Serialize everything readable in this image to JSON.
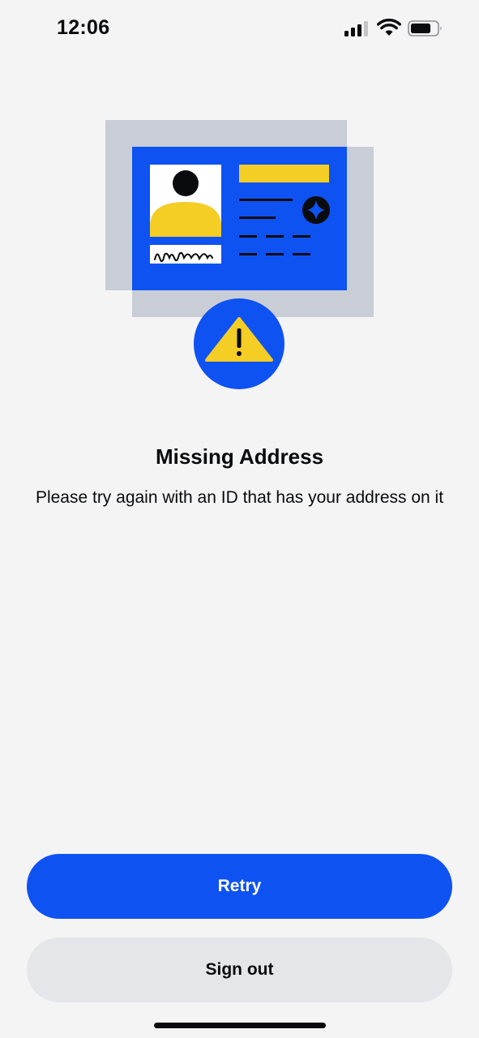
{
  "status_bar": {
    "time": "12:06",
    "icons": [
      "cellular-signal-icon",
      "wifi-icon",
      "battery-icon"
    ]
  },
  "illustration": {
    "icon": "id-card-warning-icon",
    "colors": {
      "card_blue": "#0e52f2",
      "shadow_gray": "#c9cdd6",
      "accent_yellow": "#f4cd25",
      "ink": "#0a0b0d"
    }
  },
  "content": {
    "title": "Missing Address",
    "message": "Please try again with an ID that has your address on it"
  },
  "actions": {
    "retry_label": "Retry",
    "sign_out_label": "Sign out"
  },
  "colors": {
    "primary": "#0e52f2",
    "secondary_button_bg": "#e5e6ea",
    "background": "#f4f4f5",
    "text": "#0a0b0d"
  }
}
